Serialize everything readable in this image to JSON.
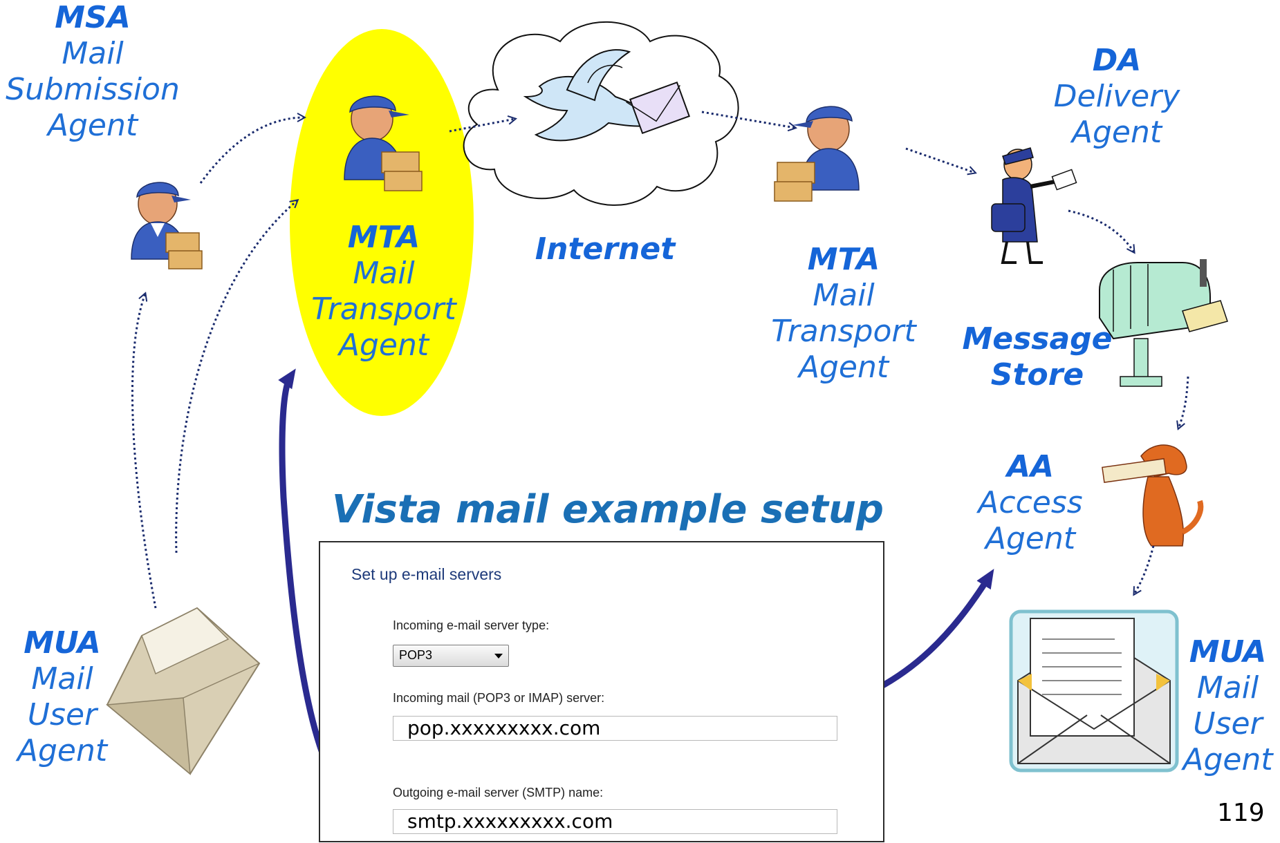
{
  "labels": {
    "msa": {
      "abbr": "MSA",
      "l1": "Mail",
      "l2": "Submission",
      "l3": "Agent"
    },
    "mta1": {
      "abbr": "MTA",
      "l1": "Mail",
      "l2": "Transport",
      "l3": "Agent"
    },
    "internet": "Internet",
    "mta2": {
      "abbr": "MTA",
      "l1": "Mail",
      "l2": "Transport",
      "l3": "Agent"
    },
    "da": {
      "abbr": "DA",
      "l1": "Delivery",
      "l2": "Agent"
    },
    "message_store": {
      "l1": "Message",
      "l2": "Store"
    },
    "aa": {
      "abbr": "AA",
      "l1": "Access",
      "l2": "Agent"
    },
    "mua_left": {
      "abbr": "MUA",
      "l1": "Mail",
      "l2": "User",
      "l3": "Agent"
    },
    "mua_right": {
      "abbr": "MUA",
      "l1": "Mail",
      "l2": "User",
      "l3": "Agent"
    }
  },
  "setup_title": "Vista mail example setup",
  "dialog": {
    "heading": "Set up e-mail servers",
    "incoming_type_label": "Incoming e-mail server type:",
    "incoming_type_value": "POP3",
    "incoming_server_label": "Incoming mail (POP3 or IMAP) server:",
    "incoming_server_value": "pop.xxxxxxxxx.com",
    "outgoing_server_label": "Outgoing e-mail server (SMTP) name:",
    "outgoing_server_value": "smtp.xxxxxxxxx.com"
  },
  "page_number": "119",
  "colors": {
    "label_blue": "#1f6fd6",
    "highlight_yellow": "#ffff00",
    "arrow_navy": "#2a2a8f"
  },
  "icons": [
    "mail-carrier-icon",
    "cloud-icon",
    "bird-icon",
    "postman-icon",
    "mailbox-icon",
    "dog-icon",
    "open-envelope-icon",
    "letter-envelope-icon"
  ]
}
